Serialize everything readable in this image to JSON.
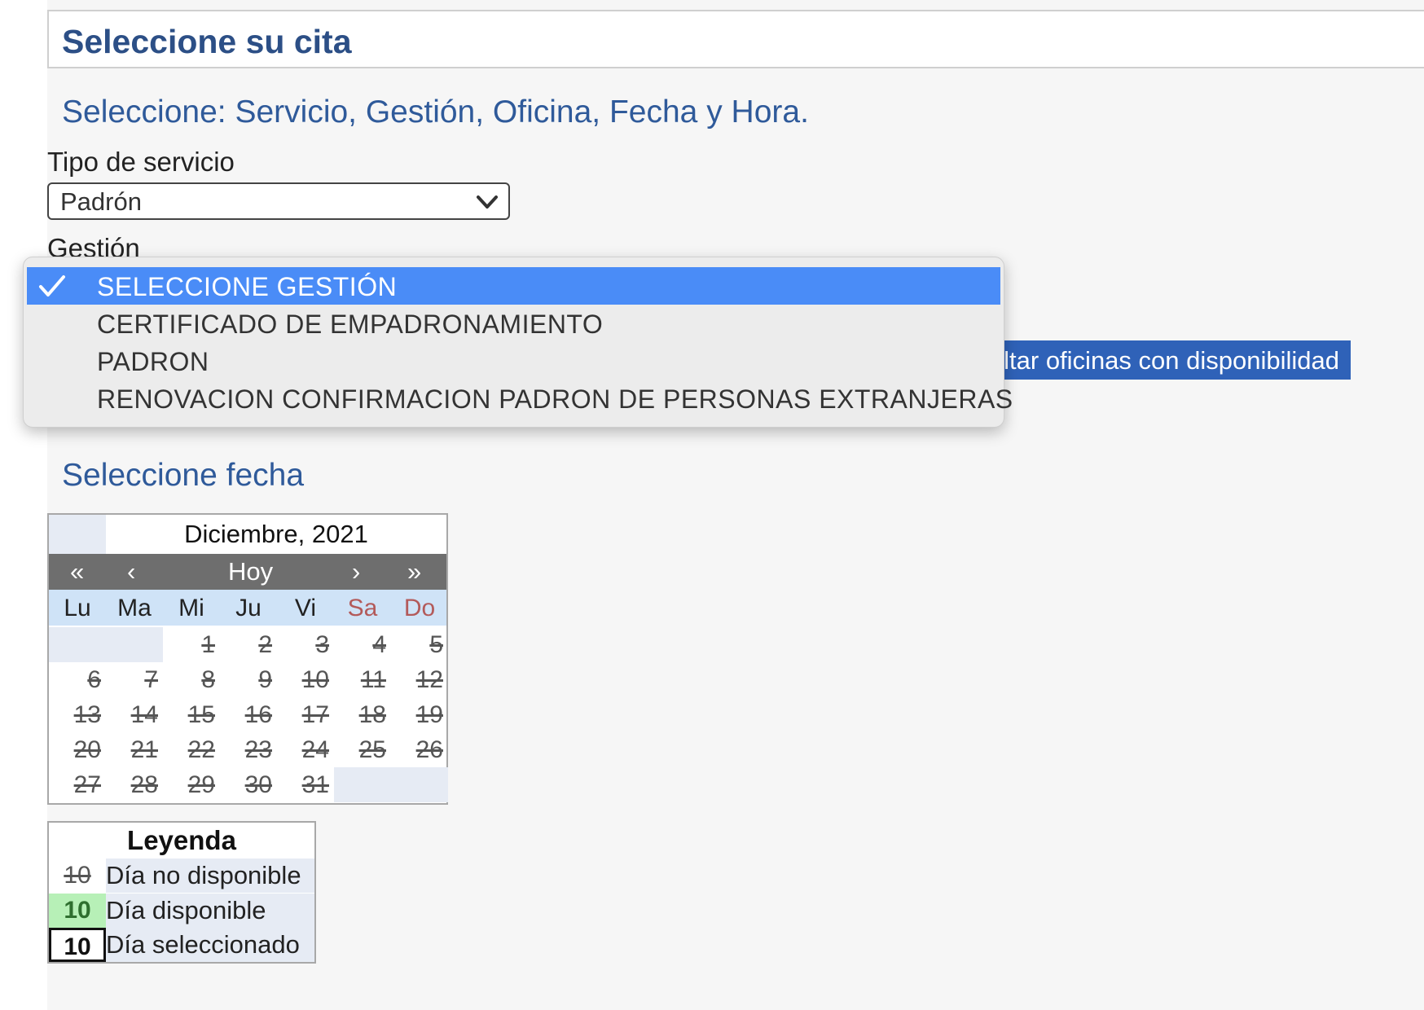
{
  "header": {
    "title": "Seleccione su cita"
  },
  "subtitle": "Seleccione: Servicio, Gestión, Oficina, Fecha y Hora.",
  "service": {
    "label": "Tipo de servicio",
    "value": "Padrón"
  },
  "gestion": {
    "label": "Gestión",
    "options": [
      "SELECCIONE GESTIÓN",
      "CERTIFICADO DE EMPADRONAMIENTO",
      "PADRON",
      "RENOVACION CONFIRMACION PADRON DE PERSONAS EXTRANJERAS"
    ],
    "selected_index": 0
  },
  "offices_button": {
    "label": "Consultar oficinas con disponibilidad"
  },
  "date_section": {
    "title": "Seleccione fecha"
  },
  "calendar": {
    "month_title": "Diciembre, 2021",
    "nav": {
      "prev_year": "«",
      "prev_month": "‹",
      "today": "Hoy",
      "next_month": "›",
      "next_year": "»"
    },
    "weekdays": [
      "Lu",
      "Ma",
      "Mi",
      "Ju",
      "Vi",
      "Sa",
      "Do"
    ],
    "weeks": [
      [
        "",
        "",
        "1",
        "2",
        "3",
        "4",
        "5"
      ],
      [
        "6",
        "7",
        "8",
        "9",
        "10",
        "11",
        "12"
      ],
      [
        "13",
        "14",
        "15",
        "16",
        "17",
        "18",
        "19"
      ],
      [
        "20",
        "21",
        "22",
        "23",
        "24",
        "25",
        "26"
      ],
      [
        "27",
        "28",
        "29",
        "30",
        "31",
        "",
        ""
      ]
    ]
  },
  "legend": {
    "title": "Leyenda",
    "items": [
      {
        "num": "10",
        "label": "Día no disponible"
      },
      {
        "num": "10",
        "label": "Día disponible"
      },
      {
        "num": "10",
        "label": "Día seleccionado"
      }
    ]
  },
  "colors": {
    "title": "#2c4f86",
    "button": "#2f62b8",
    "dropdown_selected": "#4a8cf7",
    "weekend": "#b35a5a",
    "available": "#b7f0b7"
  }
}
